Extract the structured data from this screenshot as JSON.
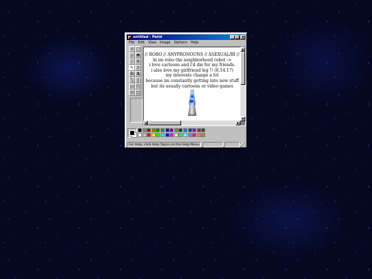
{
  "window": {
    "title": "untitled - Paint",
    "controls": [
      "_",
      "□",
      "x"
    ]
  },
  "menu": [
    "File",
    "Edit",
    "View",
    "Image",
    "Options",
    "Help"
  ],
  "tools": [
    "free-select",
    "select",
    "eraser",
    "fill",
    "picker",
    "magnifier",
    "pencil",
    "brush",
    "airbrush",
    "text",
    "line",
    "curve",
    "rectangle",
    "polygon",
    "ellipse",
    "rounded-rectangle"
  ],
  "canvas": {
    "lines": [
      "// ROBO // ANYPRONOUNS // ASEXUAL/BI //",
      "hi im robo the neighborhood robot :>",
      "i love cartoons and i'd die for my friends.",
      "i also love my girlfriend leg !! (6.14.17)",
      "my interests change a lot",
      "because im constantly getting into new stuff",
      "but its usually cartoons or video games"
    ],
    "image": "lava-lamp"
  },
  "palette": {
    "foreground": "#000000",
    "background": "#ffffff",
    "top_row": [
      "#000000",
      "#808080",
      "#800000",
      "#808000",
      "#008000",
      "#008080",
      "#000080",
      "#800080",
      "#808040",
      "#004040",
      "#0080ff",
      "#004080",
      "#8000ff",
      "#804000",
      "#404040"
    ],
    "bottom_row": [
      "#ffffff",
      "#c0c0c0",
      "#ff0000",
      "#ffff00",
      "#00ff00",
      "#00ffff",
      "#0000ff",
      "#ff00ff",
      "#ffff80",
      "#00ff80",
      "#80ffff",
      "#8080ff",
      "#ff0080",
      "#ff8040",
      "#c08040"
    ]
  },
  "status": {
    "help_text": "For Help, click Help Topics on the Help Menu."
  }
}
